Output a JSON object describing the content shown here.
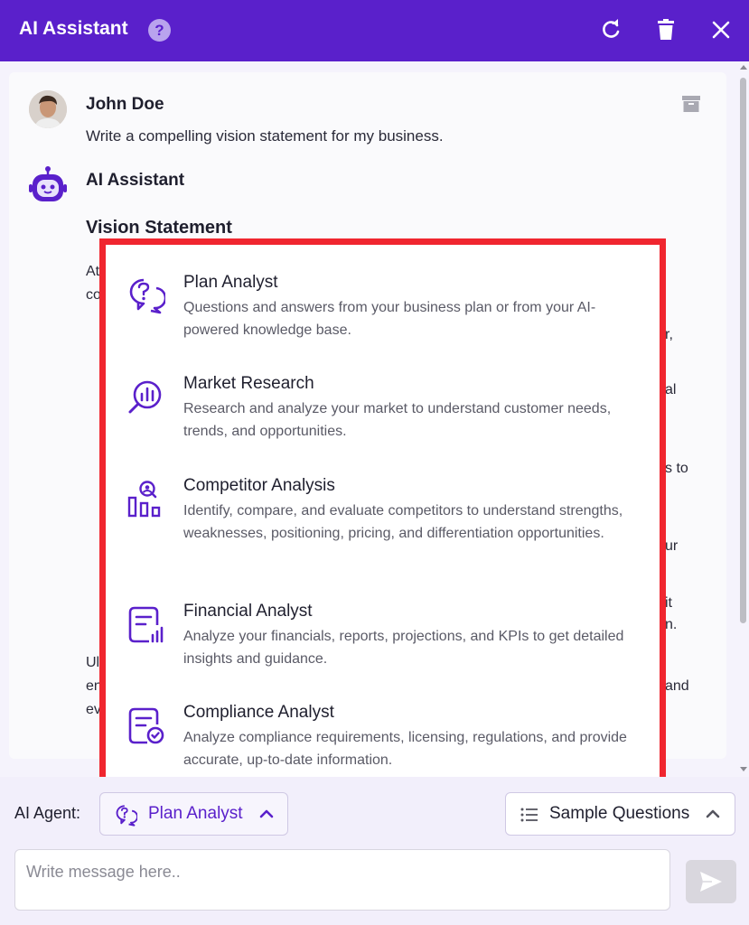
{
  "header": {
    "title": "AI Assistant",
    "help_icon": "?",
    "icons": [
      "help-circle-icon",
      "refresh-icon",
      "trash-icon",
      "close-icon"
    ]
  },
  "chat": {
    "user": {
      "name": "John Doe",
      "message": "Write a compelling vision statement for my business."
    },
    "assistant": {
      "name": "AI Assistant",
      "heading": "Vision Statement"
    },
    "partial_text": {
      "left": [
        "At",
        "co",
        "Ul",
        "en",
        "ev"
      ],
      "right": [
        "r,",
        "al",
        "s to",
        "ur",
        "it",
        "n.",
        "and"
      ]
    }
  },
  "agent_menu": {
    "items": [
      {
        "title": "Plan Analyst",
        "description": "Questions and answers from your business plan or from your AI-powered knowledge base.",
        "icon": "chat-question-icon"
      },
      {
        "title": "Market Research",
        "description": "Research and analyze your market to understand customer needs, trends, and opportunities.",
        "icon": "search-chart-icon"
      },
      {
        "title": "Competitor Analysis",
        "description": "Identify, compare, and evaluate competitors to understand strengths, weaknesses, positioning, pricing, and differentiation opportunities.",
        "icon": "competitor-icon"
      },
      {
        "title": "Financial Analyst",
        "description": "Analyze your financials, reports, projections, and KPIs to get detailed insights and guidance.",
        "icon": "financial-report-icon"
      },
      {
        "title": "Compliance Analyst",
        "description": "Analyze compliance requirements, licensing, regulations, and provide accurate, up-to-date information.",
        "icon": "compliance-icon"
      }
    ]
  },
  "footer": {
    "agent_label": "AI Agent:",
    "selected_agent": "Plan Analyst",
    "sample_questions_label": "Sample Questions",
    "message_placeholder": "Write message here.."
  },
  "colors": {
    "brand": "#5a20cb",
    "highlight_border": "#f0262f"
  }
}
